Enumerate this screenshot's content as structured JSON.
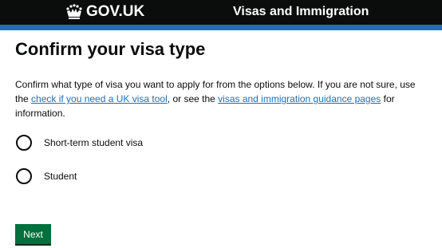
{
  "header": {
    "logo_text": "GOV.UK",
    "logo_icon": "crown-icon",
    "service_name": "Visas and Immigration",
    "background_color": "#0b0c0c",
    "stripe_color": "#1d70b8"
  },
  "main": {
    "title": "Confirm your visa type",
    "intro": {
      "text_1": "Confirm what type of visa you want to apply for from the options below. If you are not sure, use the ",
      "link_1": "check if you need a UK visa tool",
      "text_2": ", or see the ",
      "link_2": "visas and immigration guidance pages",
      "text_3": " for information."
    },
    "options": [
      {
        "label": "Short-term student visa",
        "selected": false
      },
      {
        "label": "Student",
        "selected": false
      }
    ],
    "next_label": "Next",
    "link_color": "#1d70b8",
    "button_color": "#00703c"
  }
}
